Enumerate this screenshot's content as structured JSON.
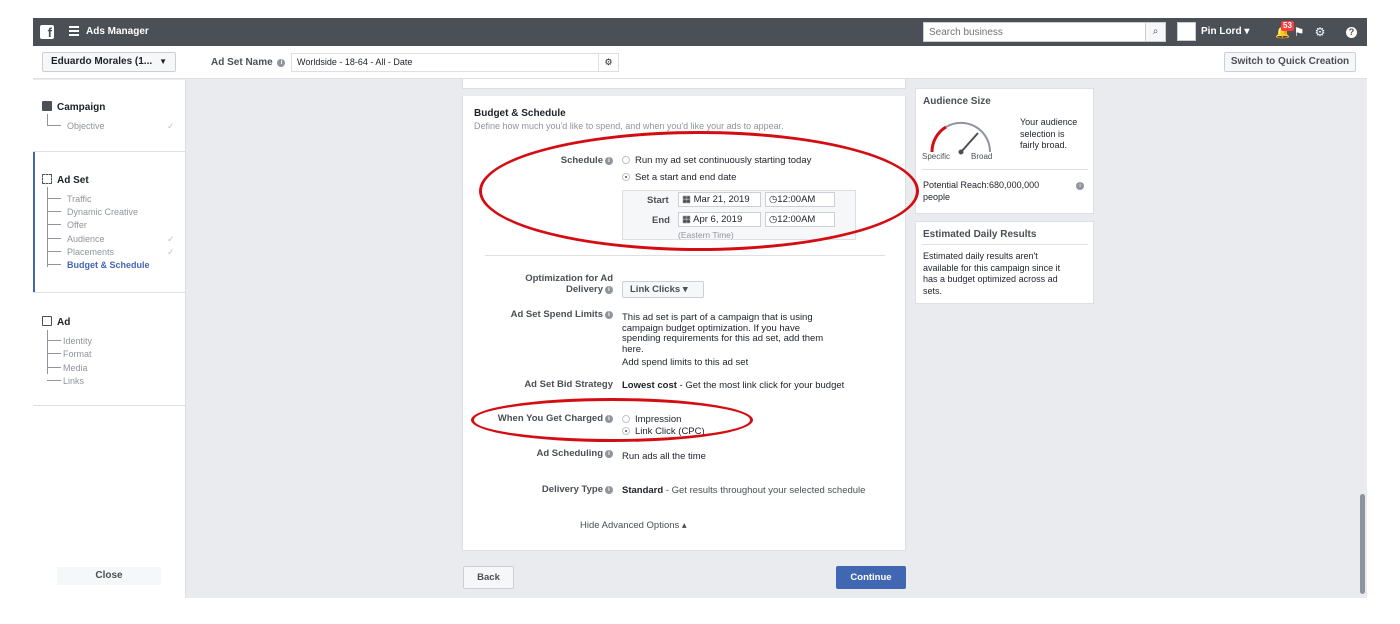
{
  "topbar": {
    "app_title": "Ads Manager",
    "search_placeholder": "Search business",
    "user_name": "Pin Lord",
    "notification_count": "53"
  },
  "subbar": {
    "account": "Eduardo Morales (1...",
    "adset_name_label": "Ad Set Name",
    "adset_name_value": "Worldside - 18-64 - All - Date",
    "quick_creation": "Switch to Quick Creation"
  },
  "sidebar": {
    "campaign": {
      "label": "Campaign",
      "items": [
        "Objective"
      ]
    },
    "adset": {
      "label": "Ad Set",
      "items": [
        "Traffic",
        "Dynamic Creative",
        "Offer",
        "Audience",
        "Placements",
        "Budget & Schedule"
      ]
    },
    "ad": {
      "label": "Ad",
      "items": [
        "Identity",
        "Format",
        "Media",
        "Links"
      ]
    },
    "close": "Close"
  },
  "budget": {
    "title": "Budget & Schedule",
    "subtitle": "Define how much you'd like to spend, and when you'd like your ads to appear.",
    "schedule_label": "Schedule",
    "schedule_opt1": "Run my ad set continuously starting today",
    "schedule_opt2": "Set a start and end date",
    "start_label": "Start",
    "start_date": "Mar 21, 2019",
    "start_time": "12:00AM",
    "end_label": "End",
    "end_date": "Apr 6, 2019",
    "end_time": "12:00AM",
    "timezone": "(Eastern Time)",
    "optimization_label_1": "Optimization for Ad",
    "optimization_label_2": "Delivery",
    "optimization_value": "Link Clicks",
    "spend_limits_label": "Ad Set Spend Limits",
    "spend_limits_text_1": "This ad set is part of a campaign that is using",
    "spend_limits_text_2": "campaign budget optimization. If you have",
    "spend_limits_text_3": "spending requirements for this ad set, add them",
    "spend_limits_text_4": "here.",
    "spend_limits_link": "Add spend limits to this ad set",
    "bid_label": "Ad Set Bid Strategy",
    "bid_value_bold": "Lowest cost",
    "bid_value_rest": " - Get the most link click for your budget",
    "charged_label": "When You Get Charged",
    "charged_opt1": "Impression",
    "charged_opt2": "Link Click (CPC)",
    "scheduling_label": "Ad Scheduling",
    "scheduling_value": "Run ads all the time",
    "delivery_label": "Delivery Type",
    "delivery_value_bold": "Standard",
    "delivery_value_rest": " - Get results throughout your selected schedule",
    "hide_advanced": "Hide Advanced Options ▴"
  },
  "buttons": {
    "back": "Back",
    "continue": "Continue"
  },
  "audience": {
    "title": "Audience Size",
    "gauge_left": "Specific",
    "gauge_right": "Broad",
    "description_1": "Your audience",
    "description_2": "selection is",
    "description_3": "fairly broad.",
    "reach_1": "Potential Reach:680,000,000",
    "reach_2": "people"
  },
  "estimated": {
    "title": "Estimated Daily Results",
    "text_1": "Estimated daily results aren't",
    "text_2": "available for this campaign since it",
    "text_3": "has a budget optimized across ad",
    "text_4": "sets."
  },
  "colors": {
    "accent": "#4267b2",
    "topbar": "#4b4f56",
    "annotation": "#d40d12"
  }
}
